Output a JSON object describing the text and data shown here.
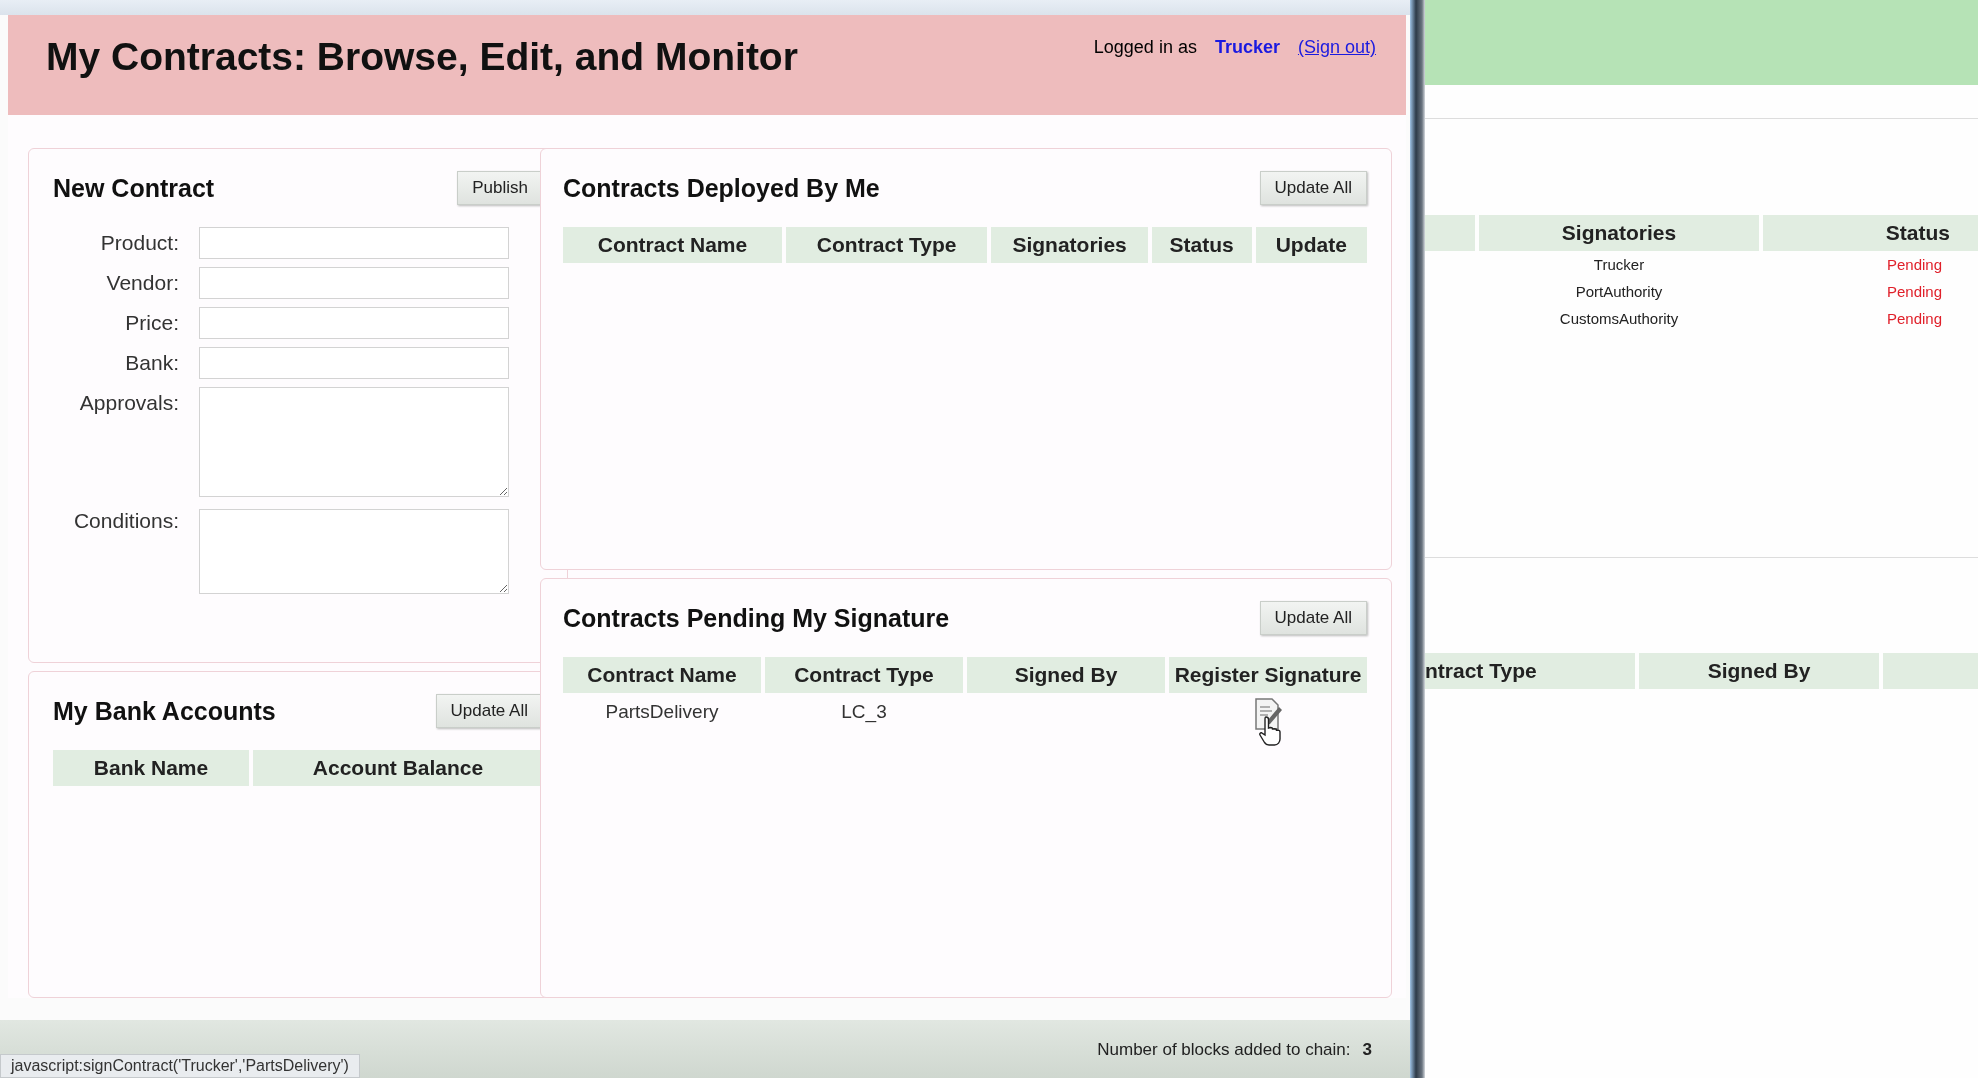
{
  "header": {
    "title": "My Contracts: Browse, Edit, and Monitor",
    "logged_in_label": "Logged in as",
    "user": "Trucker",
    "sign_out": "(Sign out)"
  },
  "new_contract": {
    "title": "New Contract",
    "button": "Publish",
    "fields": [
      {
        "label": "Product:",
        "kind": "text"
      },
      {
        "label": "Vendor:",
        "kind": "text"
      },
      {
        "label": "Price:",
        "kind": "text"
      },
      {
        "label": "Bank:",
        "kind": "text"
      },
      {
        "label": "Approvals:",
        "kind": "textarea"
      },
      {
        "label": "Conditions:",
        "kind": "textarea"
      }
    ]
  },
  "bank_accounts": {
    "title": "My Bank Accounts",
    "button": "Update All",
    "columns": [
      "Bank Name",
      "Account Balance"
    ]
  },
  "deployed": {
    "title": "Contracts Deployed By Me",
    "button": "Update All",
    "columns": [
      "Contract Name",
      "Contract Type",
      "Signatories",
      "Status",
      "Update"
    ]
  },
  "pending": {
    "title": "Contracts Pending My Signature",
    "button": "Update All",
    "columns": [
      "Contract Name",
      "Contract Type",
      "Signed By",
      "Register Signature"
    ],
    "rows": [
      {
        "contract_name": "PartsDelivery",
        "contract_type": "LC_3"
      }
    ]
  },
  "footer": {
    "blocks_label": "Number of blocks added to chain:",
    "blocks_count": "3"
  },
  "status_url": "javascript:signContract('Trucker','PartsDelivery')",
  "second_window": {
    "signatories_table": {
      "columns": [
        "Signatories",
        "Status"
      ],
      "rows": [
        {
          "signatory": "Trucker",
          "status": "Pending"
        },
        {
          "signatory": "PortAuthority",
          "status": "Pending"
        },
        {
          "signatory": "CustomsAuthority",
          "status": "Pending"
        }
      ]
    },
    "lower_table": {
      "columns": [
        "ntract Type",
        "Signed By"
      ]
    }
  }
}
